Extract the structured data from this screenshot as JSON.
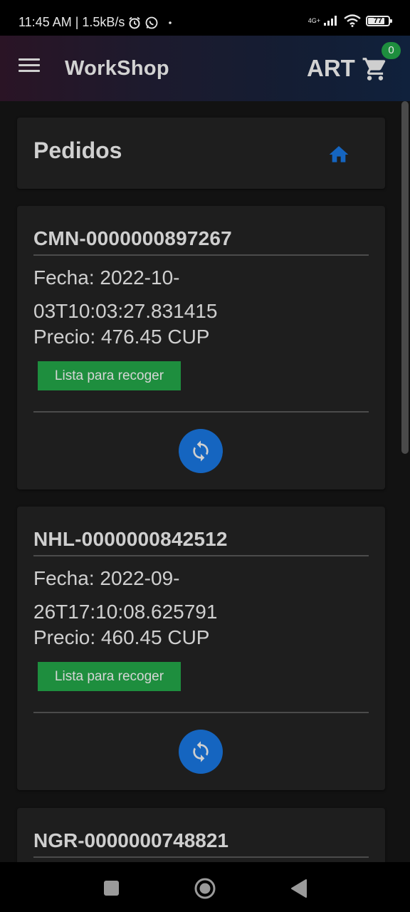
{
  "status_bar": {
    "time_text": "11:45 AM | 1.5kB/s",
    "network_label": "4G+",
    "battery": "77"
  },
  "app_bar": {
    "title": "WorkShop",
    "brand": "ART",
    "cart_count": "0"
  },
  "header": {
    "title": "Pedidos"
  },
  "orders": [
    {
      "code": "CMN-0000000897267",
      "date": "Fecha: 2022-10-03T10:03:27.831415",
      "price": "Precio: 476.45 CUP",
      "status": "Lista para recoger"
    },
    {
      "code": "NHL-0000000842512",
      "date": "Fecha: 2022-09-26T17:10:08.625791",
      "price": "Precio: 460.45 CUP",
      "status": "Lista para recoger"
    },
    {
      "code": "NGR-0000000748821"
    }
  ],
  "colors": {
    "accent_blue": "#1565c0",
    "status_green": "#1e8e3e",
    "card_bg": "#1e1e1e",
    "page_bg": "#121212"
  },
  "icons": {
    "menu": "menu-icon",
    "cart": "cart-icon",
    "home": "home-icon",
    "refresh": "refresh-icon",
    "nav_recents": "square-icon",
    "nav_home": "circle-icon",
    "nav_back": "triangle-back-icon"
  }
}
